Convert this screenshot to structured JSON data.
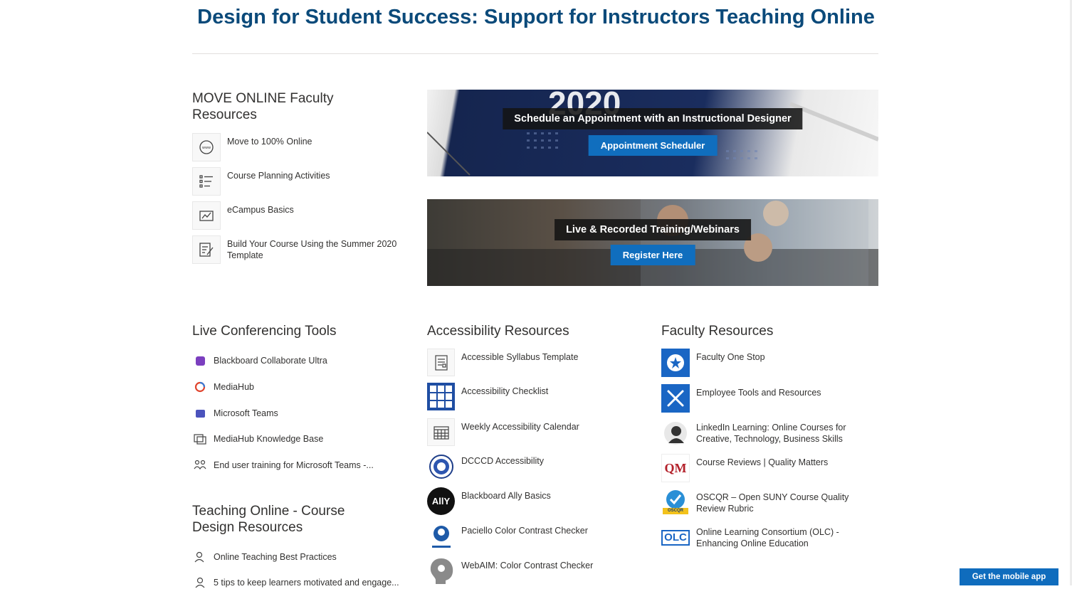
{
  "page": {
    "title": "Design for Student Success: Support for Instructors Teaching Online"
  },
  "move_online": {
    "title": "MOVE ONLINE Faculty Resources",
    "items": [
      {
        "label": "Move to 100% Online",
        "icon": "globe-icon"
      },
      {
        "label": "Course Planning Activities",
        "icon": "list-icon"
      },
      {
        "label": "eCampus Basics",
        "icon": "chart-icon"
      },
      {
        "label": "Build Your Course Using the Summer 2020 Template",
        "icon": "edit-form-icon"
      }
    ]
  },
  "banners": [
    {
      "caption": "Schedule an Appointment with an Instructional Designer",
      "button": "Appointment Scheduler",
      "year": "2020"
    },
    {
      "caption": "Live & Recorded Training/Webinars",
      "button": "Register Here"
    }
  ],
  "live_tools": {
    "title": "Live Conferencing Tools",
    "items": [
      {
        "label": "Blackboard Collaborate Ultra",
        "icon": "collaborate-icon",
        "color": "#7b3fbf"
      },
      {
        "label": "MediaHub",
        "icon": "mediahub-icon",
        "color": "#e0452e"
      },
      {
        "label": "Microsoft Teams",
        "icon": "teams-icon",
        "color": "#4b53bc"
      },
      {
        "label": "MediaHub Knowledge Base",
        "icon": "image-gallery-icon"
      },
      {
        "label": "End user training for Microsoft Teams -...",
        "icon": "people-icon"
      }
    ]
  },
  "teaching": {
    "title": "Teaching Online - Course Design Resources",
    "items": [
      {
        "label": "Online Teaching Best Practices",
        "icon": "person-icon"
      },
      {
        "label": "5 tips to keep learners motivated and engage...",
        "icon": "person-outline-icon"
      }
    ]
  },
  "accessibility": {
    "title": "Accessibility Resources",
    "items": [
      {
        "label": "Accessible Syllabus Template",
        "icon": "document-icon"
      },
      {
        "label": "Accessibility Checklist",
        "icon": "accessibility-grid-icon"
      },
      {
        "label": "Weekly Accessibility Calendar",
        "icon": "calendar-icon"
      },
      {
        "label": "DCCCD Accessibility",
        "icon": "seal-icon"
      },
      {
        "label": "Blackboard Ally Basics",
        "icon": "ally-logo-icon",
        "logo_text": "AllY"
      },
      {
        "label": "Paciello Color Contrast Checker",
        "icon": "paciello-logo-icon"
      },
      {
        "label": "WebAIM: Color Contrast Checker",
        "icon": "webaim-logo-icon"
      }
    ]
  },
  "faculty": {
    "title": "Faculty Resources",
    "items": [
      {
        "label": "Faculty One Stop",
        "icon": "star-badge-icon"
      },
      {
        "label": "Employee Tools and Resources",
        "icon": "tools-icon"
      },
      {
        "label": "LinkedIn Learning: Online Courses for Creative, Technology, Business Skills",
        "icon": "linkedin-learning-icon"
      },
      {
        "label": "Course Reviews | Quality Matters",
        "icon": "qm-logo-icon",
        "logo_text": "QM"
      },
      {
        "label": "OSCQR – Open SUNY Course Quality Review Rubric",
        "icon": "oscqr-logo-icon",
        "logo_text": "OSCQR"
      },
      {
        "label": "Online Learning Consortium (OLC) - Enhancing Online Education",
        "icon": "olc-logo-icon",
        "logo_text": "OLC"
      }
    ]
  },
  "mobile_app": {
    "label": "Get the mobile app"
  },
  "colors": {
    "title": "#0b4a7a",
    "button": "#106ebe"
  }
}
